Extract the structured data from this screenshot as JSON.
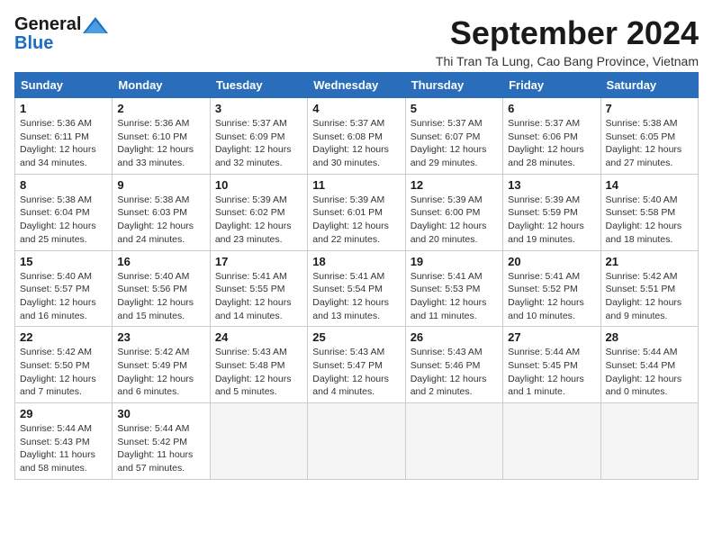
{
  "header": {
    "logo_general": "General",
    "logo_blue": "Blue",
    "month_title": "September 2024",
    "subtitle": "Thi Tran Ta Lung, Cao Bang Province, Vietnam"
  },
  "weekdays": [
    "Sunday",
    "Monday",
    "Tuesday",
    "Wednesday",
    "Thursday",
    "Friday",
    "Saturday"
  ],
  "weeks": [
    [
      {
        "day": "1",
        "sunrise": "5:36 AM",
        "sunset": "6:11 PM",
        "daylight": "12 hours and 34 minutes."
      },
      {
        "day": "2",
        "sunrise": "5:36 AM",
        "sunset": "6:10 PM",
        "daylight": "12 hours and 33 minutes."
      },
      {
        "day": "3",
        "sunrise": "5:37 AM",
        "sunset": "6:09 PM",
        "daylight": "12 hours and 32 minutes."
      },
      {
        "day": "4",
        "sunrise": "5:37 AM",
        "sunset": "6:08 PM",
        "daylight": "12 hours and 30 minutes."
      },
      {
        "day": "5",
        "sunrise": "5:37 AM",
        "sunset": "6:07 PM",
        "daylight": "12 hours and 29 minutes."
      },
      {
        "day": "6",
        "sunrise": "5:37 AM",
        "sunset": "6:06 PM",
        "daylight": "12 hours and 28 minutes."
      },
      {
        "day": "7",
        "sunrise": "5:38 AM",
        "sunset": "6:05 PM",
        "daylight": "12 hours and 27 minutes."
      }
    ],
    [
      {
        "day": "8",
        "sunrise": "5:38 AM",
        "sunset": "6:04 PM",
        "daylight": "12 hours and 25 minutes."
      },
      {
        "day": "9",
        "sunrise": "5:38 AM",
        "sunset": "6:03 PM",
        "daylight": "12 hours and 24 minutes."
      },
      {
        "day": "10",
        "sunrise": "5:39 AM",
        "sunset": "6:02 PM",
        "daylight": "12 hours and 23 minutes."
      },
      {
        "day": "11",
        "sunrise": "5:39 AM",
        "sunset": "6:01 PM",
        "daylight": "12 hours and 22 minutes."
      },
      {
        "day": "12",
        "sunrise": "5:39 AM",
        "sunset": "6:00 PM",
        "daylight": "12 hours and 20 minutes."
      },
      {
        "day": "13",
        "sunrise": "5:39 AM",
        "sunset": "5:59 PM",
        "daylight": "12 hours and 19 minutes."
      },
      {
        "day": "14",
        "sunrise": "5:40 AM",
        "sunset": "5:58 PM",
        "daylight": "12 hours and 18 minutes."
      }
    ],
    [
      {
        "day": "15",
        "sunrise": "5:40 AM",
        "sunset": "5:57 PM",
        "daylight": "12 hours and 16 minutes."
      },
      {
        "day": "16",
        "sunrise": "5:40 AM",
        "sunset": "5:56 PM",
        "daylight": "12 hours and 15 minutes."
      },
      {
        "day": "17",
        "sunrise": "5:41 AM",
        "sunset": "5:55 PM",
        "daylight": "12 hours and 14 minutes."
      },
      {
        "day": "18",
        "sunrise": "5:41 AM",
        "sunset": "5:54 PM",
        "daylight": "12 hours and 13 minutes."
      },
      {
        "day": "19",
        "sunrise": "5:41 AM",
        "sunset": "5:53 PM",
        "daylight": "12 hours and 11 minutes."
      },
      {
        "day": "20",
        "sunrise": "5:41 AM",
        "sunset": "5:52 PM",
        "daylight": "12 hours and 10 minutes."
      },
      {
        "day": "21",
        "sunrise": "5:42 AM",
        "sunset": "5:51 PM",
        "daylight": "12 hours and 9 minutes."
      }
    ],
    [
      {
        "day": "22",
        "sunrise": "5:42 AM",
        "sunset": "5:50 PM",
        "daylight": "12 hours and 7 minutes."
      },
      {
        "day": "23",
        "sunrise": "5:42 AM",
        "sunset": "5:49 PM",
        "daylight": "12 hours and 6 minutes."
      },
      {
        "day": "24",
        "sunrise": "5:43 AM",
        "sunset": "5:48 PM",
        "daylight": "12 hours and 5 minutes."
      },
      {
        "day": "25",
        "sunrise": "5:43 AM",
        "sunset": "5:47 PM",
        "daylight": "12 hours and 4 minutes."
      },
      {
        "day": "26",
        "sunrise": "5:43 AM",
        "sunset": "5:46 PM",
        "daylight": "12 hours and 2 minutes."
      },
      {
        "day": "27",
        "sunrise": "5:44 AM",
        "sunset": "5:45 PM",
        "daylight": "12 hours and 1 minute."
      },
      {
        "day": "28",
        "sunrise": "5:44 AM",
        "sunset": "5:44 PM",
        "daylight": "12 hours and 0 minutes."
      }
    ],
    [
      {
        "day": "29",
        "sunrise": "5:44 AM",
        "sunset": "5:43 PM",
        "daylight": "11 hours and 58 minutes."
      },
      {
        "day": "30",
        "sunrise": "5:44 AM",
        "sunset": "5:42 PM",
        "daylight": "11 hours and 57 minutes."
      },
      null,
      null,
      null,
      null,
      null
    ]
  ],
  "labels": {
    "sunrise_prefix": "Sunrise: ",
    "sunset_prefix": "Sunset: ",
    "daylight_prefix": "Daylight: "
  }
}
